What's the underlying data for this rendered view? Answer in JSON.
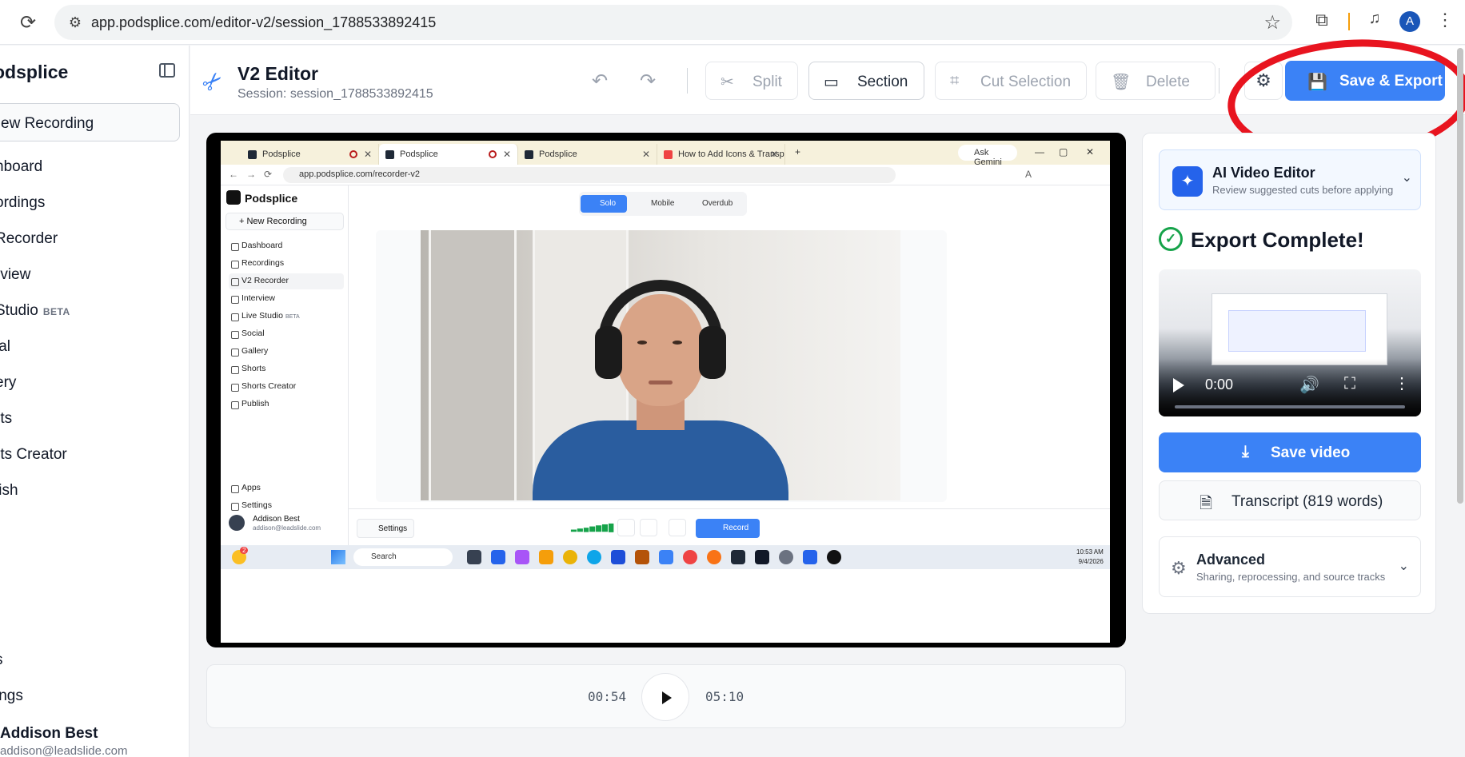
{
  "browser": {
    "url": "app.podsplice.com/editor-v2/session_1788533892415",
    "profile_initial": "A",
    "icons": [
      "reload-icon",
      "tune-icon",
      "star-icon",
      "extensions-icon",
      "media-icon",
      "kebab-icon"
    ]
  },
  "sidebar": {
    "brand": "odsplice",
    "new_recording": "ew Recording",
    "items": [
      {
        "label": "hboard"
      },
      {
        "label": "ordings"
      },
      {
        "label": "Recorder"
      },
      {
        "label": "rview"
      },
      {
        "label": " Studio",
        "badge": "BETA"
      },
      {
        "label": "ial"
      },
      {
        "label": "ery"
      },
      {
        "label": "rts"
      },
      {
        "label": "rts Creator"
      },
      {
        "label": "lish"
      }
    ],
    "bottom_items": [
      {
        "label": "s"
      },
      {
        "label": "ings"
      }
    ],
    "user": {
      "name": "Addison Best",
      "email": "addison@leadslide.com"
    }
  },
  "header": {
    "title": "V2 Editor",
    "session": "Session: session_1788533892415",
    "tools": {
      "split": "Split",
      "section": "Section",
      "cut_selection": "Cut Selection",
      "delete": "Delete"
    },
    "save_export": "Save & Export",
    "annotation_color": "#e8141f"
  },
  "preview": {
    "tabs": [
      {
        "label": "Podsplice"
      },
      {
        "label": "Podsplice"
      },
      {
        "label": "Podsplice"
      },
      {
        "label": "How to Add Icons & Transpare"
      }
    ],
    "ask_gemini": "Ask Gemini",
    "url": "app.podsplice.com/recorder-v2",
    "profile_initial": "A",
    "brand": "Podsplice",
    "new_recording": "+ New Recording",
    "items": [
      {
        "label": "Dashboard"
      },
      {
        "label": "Recordings"
      },
      {
        "label": "V2 Recorder"
      },
      {
        "label": "Interview"
      },
      {
        "label": "Live Studio",
        "badge": "BETA"
      },
      {
        "label": "Social"
      },
      {
        "label": "Gallery"
      },
      {
        "label": "Shorts"
      },
      {
        "label": "Shorts Creator"
      },
      {
        "label": "Publish"
      }
    ],
    "bottom_items": [
      {
        "label": "Apps"
      },
      {
        "label": "Settings"
      }
    ],
    "user": {
      "name": "Addison Best",
      "email": "addison@leadslide.com"
    },
    "modes": {
      "solo": "Solo",
      "mobile": "Mobile",
      "overdub": "Overdub"
    },
    "settings_label": "Settings",
    "record_label": "Record",
    "taskbar": {
      "search": "Search",
      "notif_count": "2",
      "time": "10:53 AM",
      "date": "9/4/2026"
    }
  },
  "player": {
    "current_time": "00:54",
    "total_time": "05:10"
  },
  "right_panel": {
    "ai_editor": {
      "title": "AI Video Editor",
      "subtitle": "Review suggested cuts before applying"
    },
    "export_title": "Export Complete!",
    "video_time": "0:00",
    "save_video": "Save video",
    "transcript": "Transcript (819 words)",
    "advanced": {
      "title": "Advanced",
      "subtitle": "Sharing, reprocessing, and source tracks"
    }
  },
  "colors": {
    "accent": "#3b82f6",
    "success": "#16a34a"
  }
}
